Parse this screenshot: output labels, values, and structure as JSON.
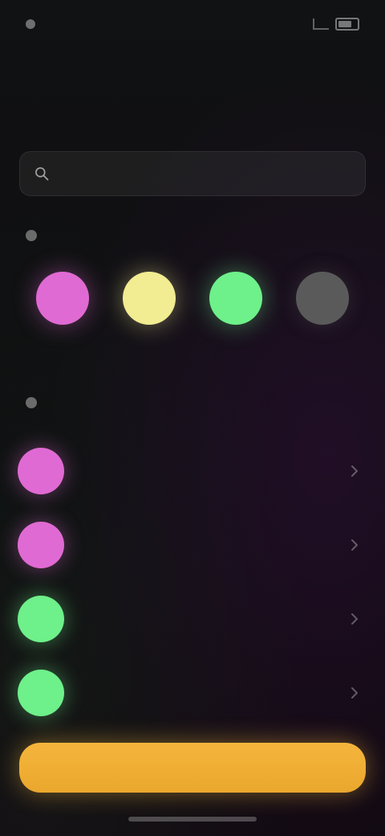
{
  "status_bar": {
    "time": "",
    "signal_icon": "signal-icon",
    "battery_icon": "battery-icon"
  },
  "header": {
    "title": "",
    "subtitle": ""
  },
  "search": {
    "text": "",
    "icon": "search-icon"
  },
  "sections": [
    {
      "title": ""
    },
    {
      "title": ""
    }
  ],
  "swatches": [
    {
      "label": "",
      "color": "#e06ad3"
    },
    {
      "label": "",
      "color": "#f2ec92"
    },
    {
      "label": "",
      "color": "#6ef08a"
    },
    {
      "label": "",
      "color": "#5a5a5a"
    }
  ],
  "list": [
    {
      "label": "",
      "color": "#e06ad3"
    },
    {
      "label": "",
      "color": "#e06ad3"
    },
    {
      "label": "",
      "color": "#6ef08a"
    },
    {
      "label": "",
      "color": "#6ef08a"
    }
  ],
  "primary_button": {
    "label": ""
  },
  "accent_color": "#f5b53c"
}
